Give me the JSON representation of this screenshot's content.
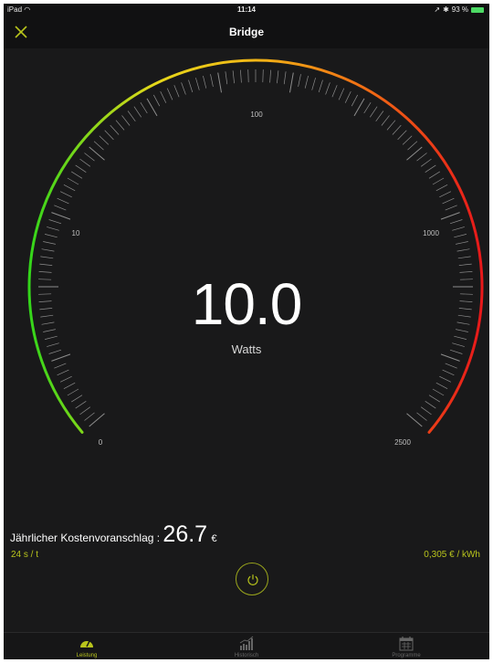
{
  "status_bar": {
    "device": "iPad",
    "time": "11:14",
    "battery": "93 %"
  },
  "nav": {
    "title": "Bridge",
    "close_icon": "close-x-icon"
  },
  "gauge": {
    "scale_labels": [
      "0",
      "10",
      "100",
      "1000",
      "2500"
    ],
    "value": "10.0",
    "unit": "Watts",
    "colors": {
      "start": "#33d61a",
      "mid_low": "#e6d81a",
      "mid": "#f2b616",
      "mid_high": "#f06a14",
      "end": "#e8181a"
    }
  },
  "cost": {
    "label": "Jährlicher Kostenvoranschlag : ",
    "value": "26.7",
    "currency": "€"
  },
  "rates": {
    "left": "24 s / t",
    "right": "0,305 € / kWh"
  },
  "power_button": {
    "icon": "power-icon"
  },
  "tabs": [
    {
      "label": "Leistung",
      "icon": "gauge-icon",
      "active": true
    },
    {
      "label": "Historisch",
      "icon": "bar-chart-icon",
      "active": false
    },
    {
      "label": "Programme",
      "icon": "calendar-icon",
      "active": false
    }
  ],
  "accent": "#b8c41c"
}
